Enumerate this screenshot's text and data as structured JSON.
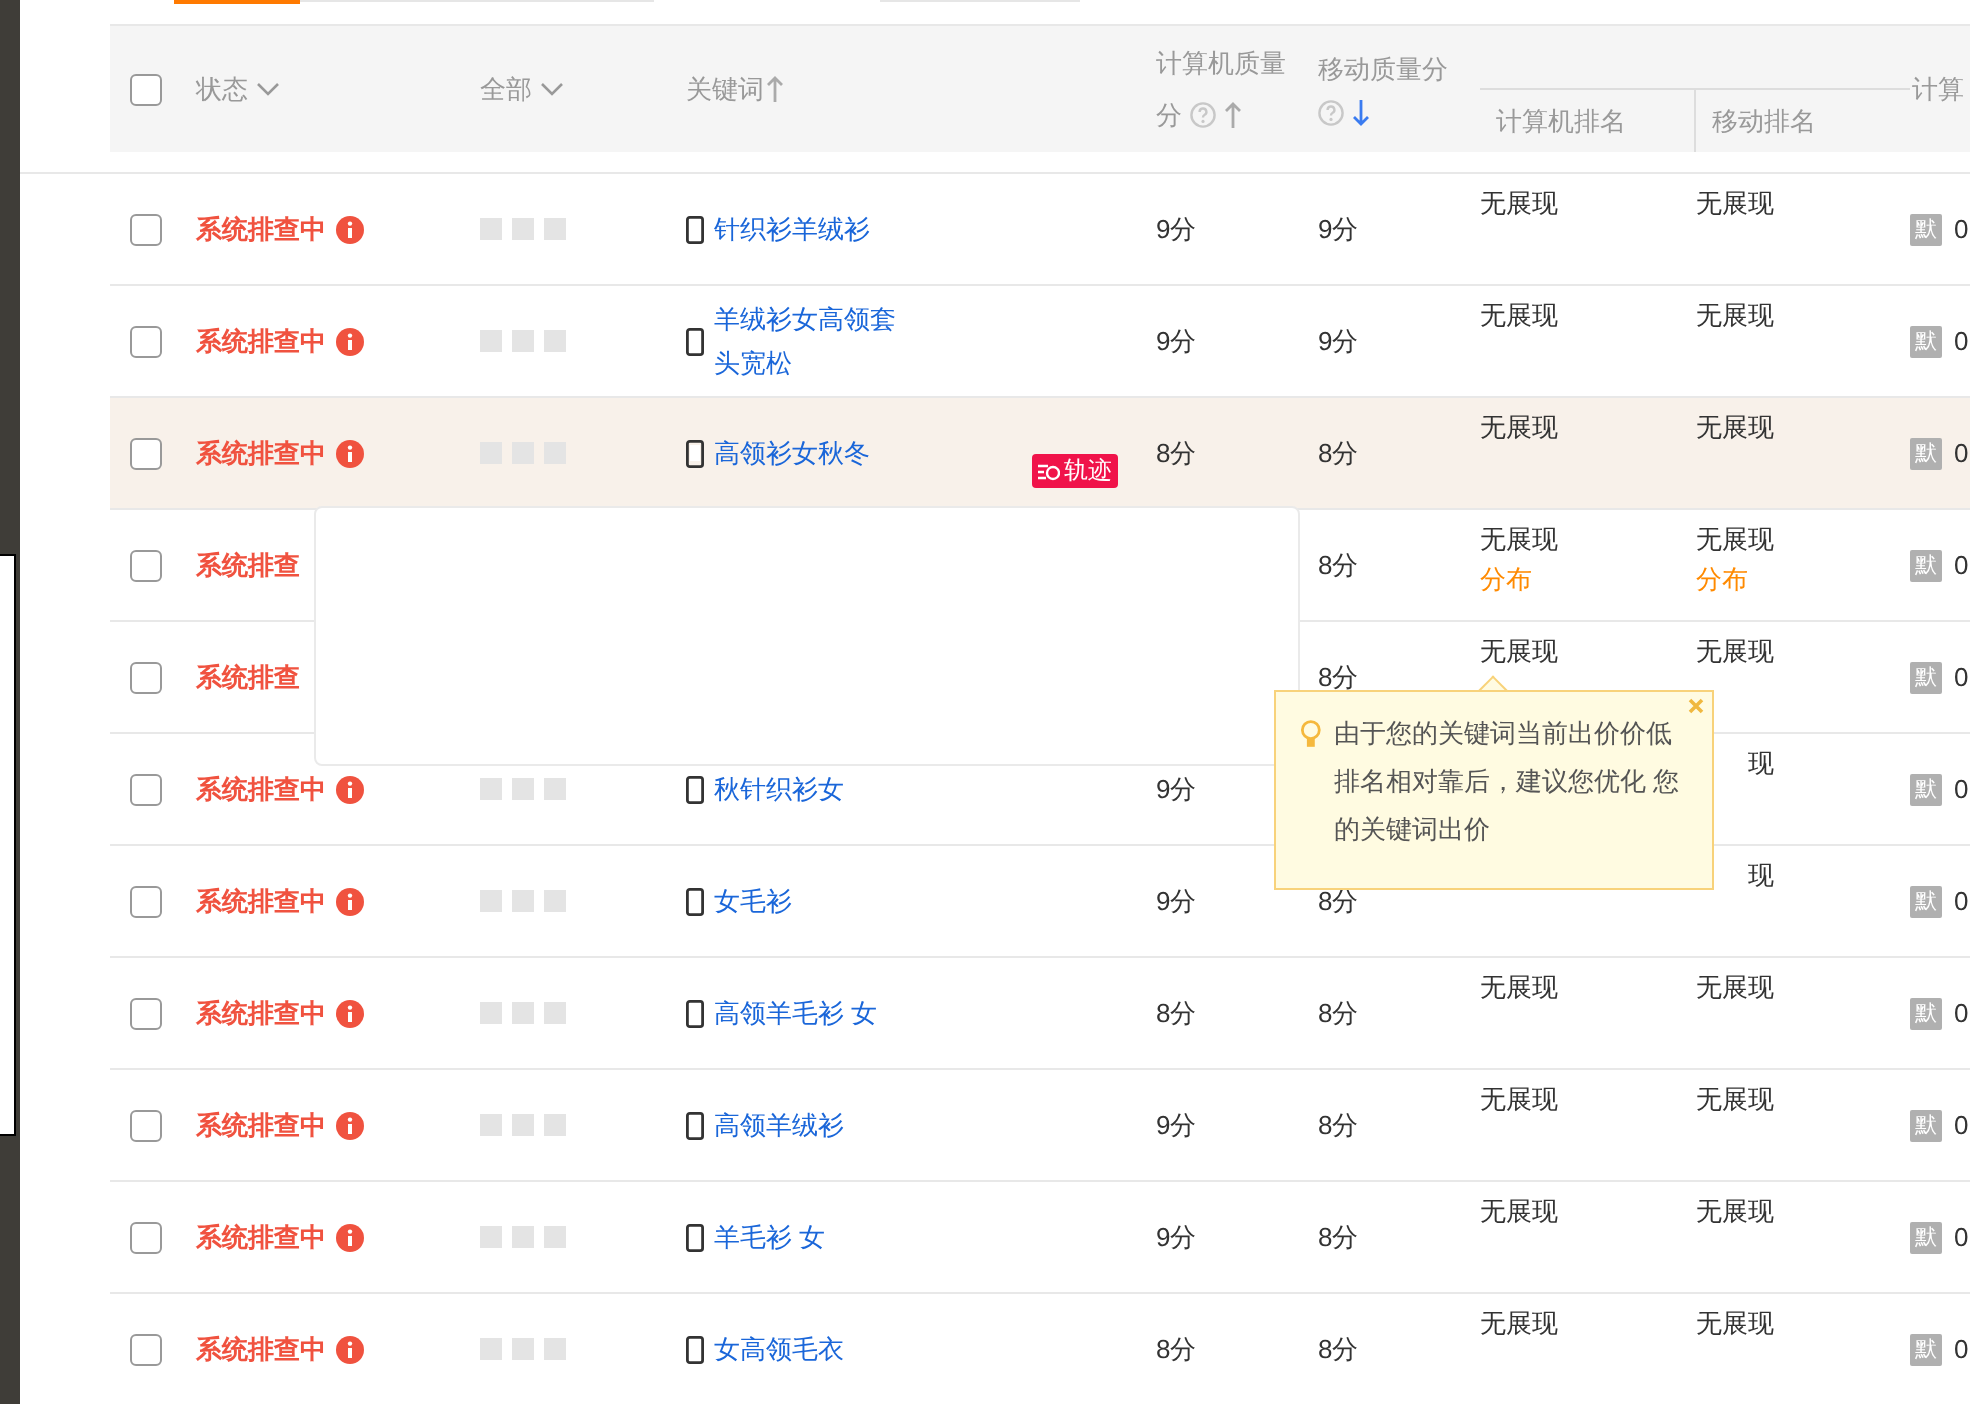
{
  "header": {
    "checked": false,
    "status": "状态",
    "all": "全部",
    "keyword": {
      "label": "关键词",
      "sort_active": false
    },
    "quality_pc": {
      "label": "计算机质量分",
      "sort_active": false
    },
    "quality_mobile": {
      "label": "移动质量分",
      "sort_active": true
    },
    "rank_pc": "计算机排名",
    "rank_mobile": "移动排名",
    "last": "计算"
  },
  "rows": [
    {
      "checked": false,
      "status": "系统排查中",
      "info": true,
      "keyword": "针织衫羊绒衫",
      "q_pc": "9分",
      "q_mobile": "9分",
      "rank_pc": "无展现",
      "rank_mobile": "无展现",
      "tag": "默",
      "value": "0",
      "highlighted": false
    },
    {
      "checked": false,
      "status": "系统排查中",
      "info": true,
      "keyword": "羊绒衫女高领套头宽松",
      "q_pc": "9分",
      "q_mobile": "9分",
      "rank_pc": "无展现",
      "rank_mobile": "无展现",
      "tag": "默",
      "value": "0",
      "highlighted": false
    },
    {
      "checked": false,
      "status": "系统排查中",
      "info": true,
      "keyword": "高领衫女秋冬",
      "badge": "轨迹",
      "q_pc": "8分",
      "q_mobile": "8分",
      "rank_pc": "无展现",
      "rank_mobile": "无展现",
      "tag": "默",
      "value": "0",
      "highlighted": true
    },
    {
      "checked": false,
      "status": "系统排查",
      "info": false,
      "q_mobile": "8分",
      "rank_pc": "无展现",
      "dist_pc": "分布",
      "rank_mobile": "无展现",
      "dist_mobile": "分布",
      "tag": "默",
      "value": "0",
      "highlighted": false
    },
    {
      "checked": false,
      "status": "系统排查",
      "info": false,
      "q_mobile": "8分",
      "rank_pc": "无展现",
      "rank_mobile": "无展现",
      "tag": "默",
      "value": "0",
      "highlighted": false
    },
    {
      "checked": false,
      "status": "系统排查中",
      "info": true,
      "keyword": "秋针织衫女",
      "q_pc": "9分",
      "rank_mobile": "现",
      "tag": "默",
      "value": "0",
      "highlighted": false
    },
    {
      "checked": false,
      "status": "系统排查中",
      "info": true,
      "keyword": "女毛衫",
      "q_pc": "9分",
      "q_mobile": "8分",
      "rank_mobile": "现",
      "tag": "默",
      "value": "0",
      "highlighted": false
    },
    {
      "checked": false,
      "status": "系统排查中",
      "info": true,
      "keyword": "高领羊毛衫 女",
      "q_pc": "8分",
      "q_mobile": "8分",
      "rank_pc": "无展现",
      "rank_mobile": "无展现",
      "tag": "默",
      "value": "0",
      "highlighted": false
    },
    {
      "checked": false,
      "status": "系统排查中",
      "info": true,
      "keyword": "高领羊绒衫",
      "q_pc": "9分",
      "q_mobile": "8分",
      "rank_pc": "无展现",
      "rank_mobile": "无展现",
      "tag": "默",
      "value": "0",
      "highlighted": false
    },
    {
      "checked": false,
      "status": "系统排查中",
      "info": true,
      "keyword": "羊毛衫 女",
      "q_pc": "9分",
      "q_mobile": "8分",
      "rank_pc": "无展现",
      "rank_mobile": "无展现",
      "tag": "默",
      "value": "0",
      "highlighted": false
    },
    {
      "checked": false,
      "status": "系统排查中",
      "info": true,
      "keyword": "女高领毛衣",
      "q_pc": "8分",
      "q_mobile": "8分",
      "rank_pc": "无展现",
      "rank_mobile": "无展现",
      "tag": "默",
      "value": "0",
      "highlighted": false
    }
  ],
  "tooltip": {
    "text": "由于您的关键词当前出价价低排名相对靠后，建议您优化 您的关键词出价"
  }
}
